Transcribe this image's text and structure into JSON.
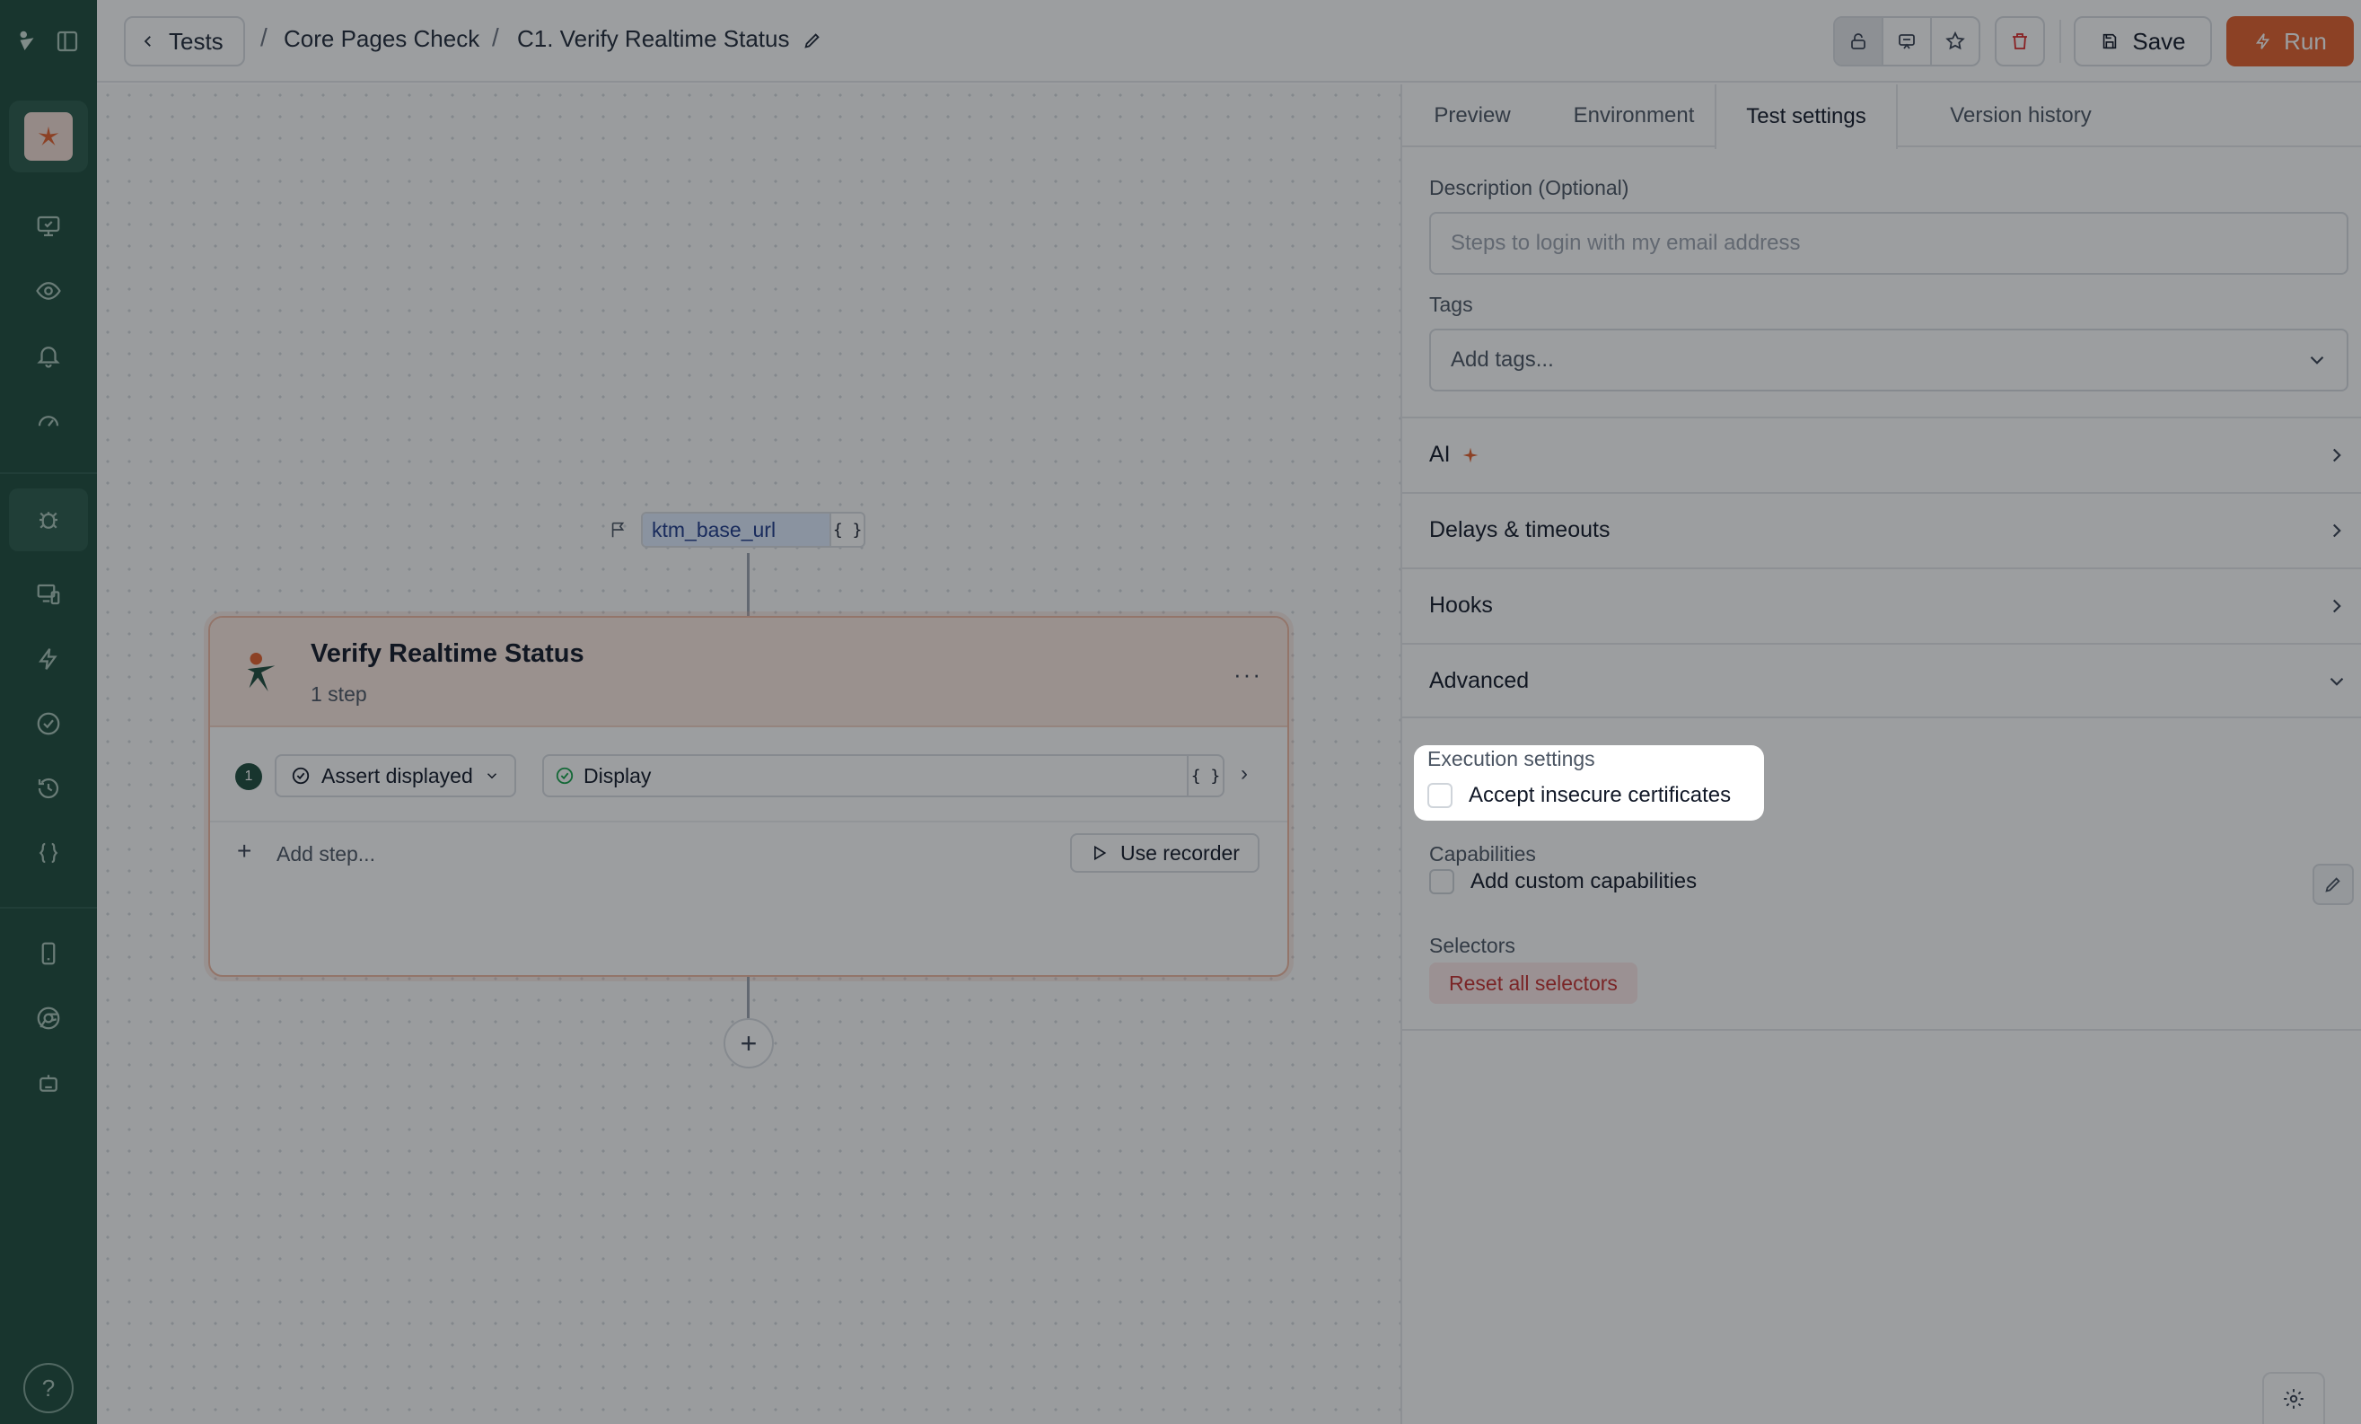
{
  "header": {
    "back_label": "Tests",
    "breadcrumbs": [
      "Core Pages Check",
      "C1. Verify Realtime Status"
    ],
    "save_label": "Save",
    "run_label": "Run"
  },
  "sidebar": {
    "icons": [
      "logo-icon",
      "panel-toggle-icon",
      "monitor-check-icon",
      "eye-icon",
      "bell-icon",
      "gauge-icon",
      "bug-icon",
      "devices-icon",
      "lightning-icon",
      "check-circle-icon",
      "history-icon",
      "braces-icon",
      "mobile-icon",
      "chrome-icon",
      "robot-icon",
      "help-icon"
    ],
    "help_label": "?"
  },
  "canvas": {
    "start_variable": "ktm_base_url",
    "brace_label": "{ }",
    "card": {
      "title": "Verify Realtime Status",
      "subtitle": "1 step",
      "menu_label": "···",
      "step_number": "1",
      "step_action": "Assert displayed",
      "step_target": "Display",
      "add_step_placeholder": "Add step...",
      "recorder_label": "Use recorder"
    }
  },
  "panel": {
    "tabs": [
      "Preview",
      "Environment",
      "Test settings",
      "Version history"
    ],
    "active_tab": "Test settings",
    "description_label": "Description (Optional)",
    "description_placeholder": "Steps to login with my email address",
    "tags_label": "Tags",
    "tags_placeholder": "Add tags...",
    "sections": [
      "AI",
      "Delays & timeouts",
      "Hooks",
      "Advanced"
    ],
    "advanced": {
      "execution_label": "Execution settings",
      "insecure_label": "Accept insecure certificates",
      "capabilities_label": "Capabilities",
      "custom_caps_label": "Add custom capabilities",
      "selectors_label": "Selectors",
      "reset_label": "Reset all selectors"
    }
  },
  "colors": {
    "sidebar": "#1d4a3c",
    "accent": "#e45f2b",
    "danger": "#c53030"
  }
}
